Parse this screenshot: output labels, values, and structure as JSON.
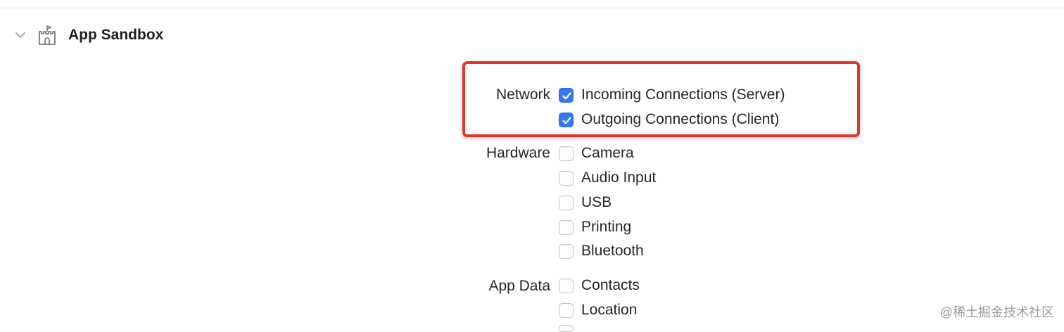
{
  "section": {
    "title": "App Sandbox",
    "disclosure_icon": "chevron-down-icon",
    "icon": "castle-icon"
  },
  "groups": {
    "network": {
      "label": "Network",
      "options": [
        {
          "label": "Incoming Connections (Server)",
          "checked": true
        },
        {
          "label": "Outgoing Connections (Client)",
          "checked": true
        }
      ]
    },
    "hardware": {
      "label": "Hardware",
      "options": [
        {
          "label": "Camera",
          "checked": false
        },
        {
          "label": "Audio Input",
          "checked": false
        },
        {
          "label": "USB",
          "checked": false
        },
        {
          "label": "Printing",
          "checked": false
        },
        {
          "label": "Bluetooth",
          "checked": false
        }
      ]
    },
    "app_data": {
      "label": "App Data",
      "options": [
        {
          "label": "Contacts",
          "checked": false
        },
        {
          "label": "Location",
          "checked": false
        }
      ]
    }
  },
  "annotation": {
    "highlight_color": "#e0372d"
  },
  "colors": {
    "checkbox_checked": "#3478f6"
  },
  "watermark": "@稀土掘金技术社区"
}
